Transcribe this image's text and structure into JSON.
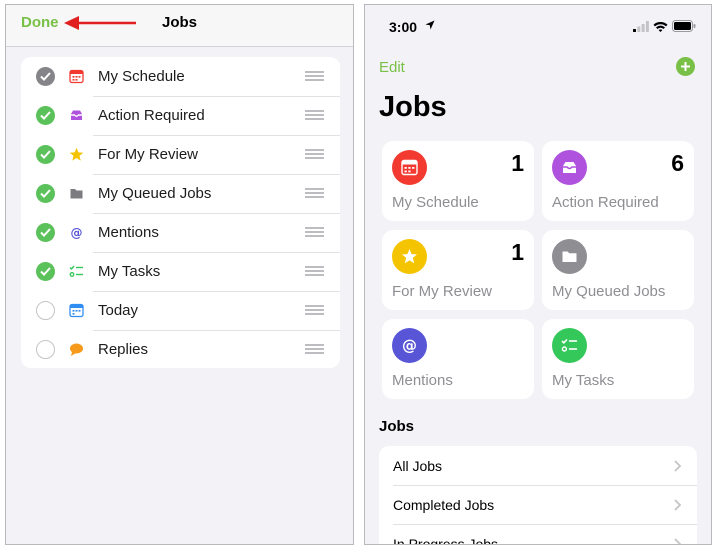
{
  "left": {
    "done_label": "Done",
    "title": "Jobs",
    "items": [
      {
        "label": "My Schedule",
        "state": "dim",
        "icon": "calendar-icon"
      },
      {
        "label": "Action Required",
        "state": "on",
        "icon": "inbox-tray-icon"
      },
      {
        "label": "For My Review",
        "state": "on",
        "icon": "star-icon"
      },
      {
        "label": "My Queued Jobs",
        "state": "on",
        "icon": "folder-icon"
      },
      {
        "label": "Mentions",
        "state": "on",
        "icon": "at-sign-icon"
      },
      {
        "label": "My Tasks",
        "state": "on",
        "icon": "checklist-icon"
      },
      {
        "label": "Today",
        "state": "off",
        "icon": "today-calendar-icon"
      },
      {
        "label": "Replies",
        "state": "off",
        "icon": "speech-bubble-icon"
      }
    ]
  },
  "right": {
    "status_time": "3:00",
    "edit_label": "Edit",
    "title": "Jobs",
    "tiles": [
      {
        "label": "My Schedule",
        "count": "1",
        "color": "#f23a30",
        "icon": "calendar-icon"
      },
      {
        "label": "Action Required",
        "count": "6",
        "color": "#af52de",
        "icon": "inbox-tray-icon"
      },
      {
        "label": "For My Review",
        "count": "1",
        "color": "#f5c400",
        "icon": "star-icon"
      },
      {
        "label": "My Queued Jobs",
        "count": "",
        "color": "#8e8e93",
        "icon": "folder-icon"
      },
      {
        "label": "Mentions",
        "count": "",
        "color": "#5856d6",
        "icon": "at-sign-icon"
      },
      {
        "label": "My Tasks",
        "count": "",
        "color": "#34c759",
        "icon": "checklist-icon"
      }
    ],
    "section_title": "Jobs",
    "jobs": [
      {
        "label": "All Jobs"
      },
      {
        "label": "Completed Jobs"
      },
      {
        "label": "In Progress Jobs"
      }
    ]
  },
  "colors": {
    "accent": "#78c046",
    "check_on": "#5bc15a",
    "check_dim": "#858589",
    "annotation_arrow": "#e02020"
  }
}
